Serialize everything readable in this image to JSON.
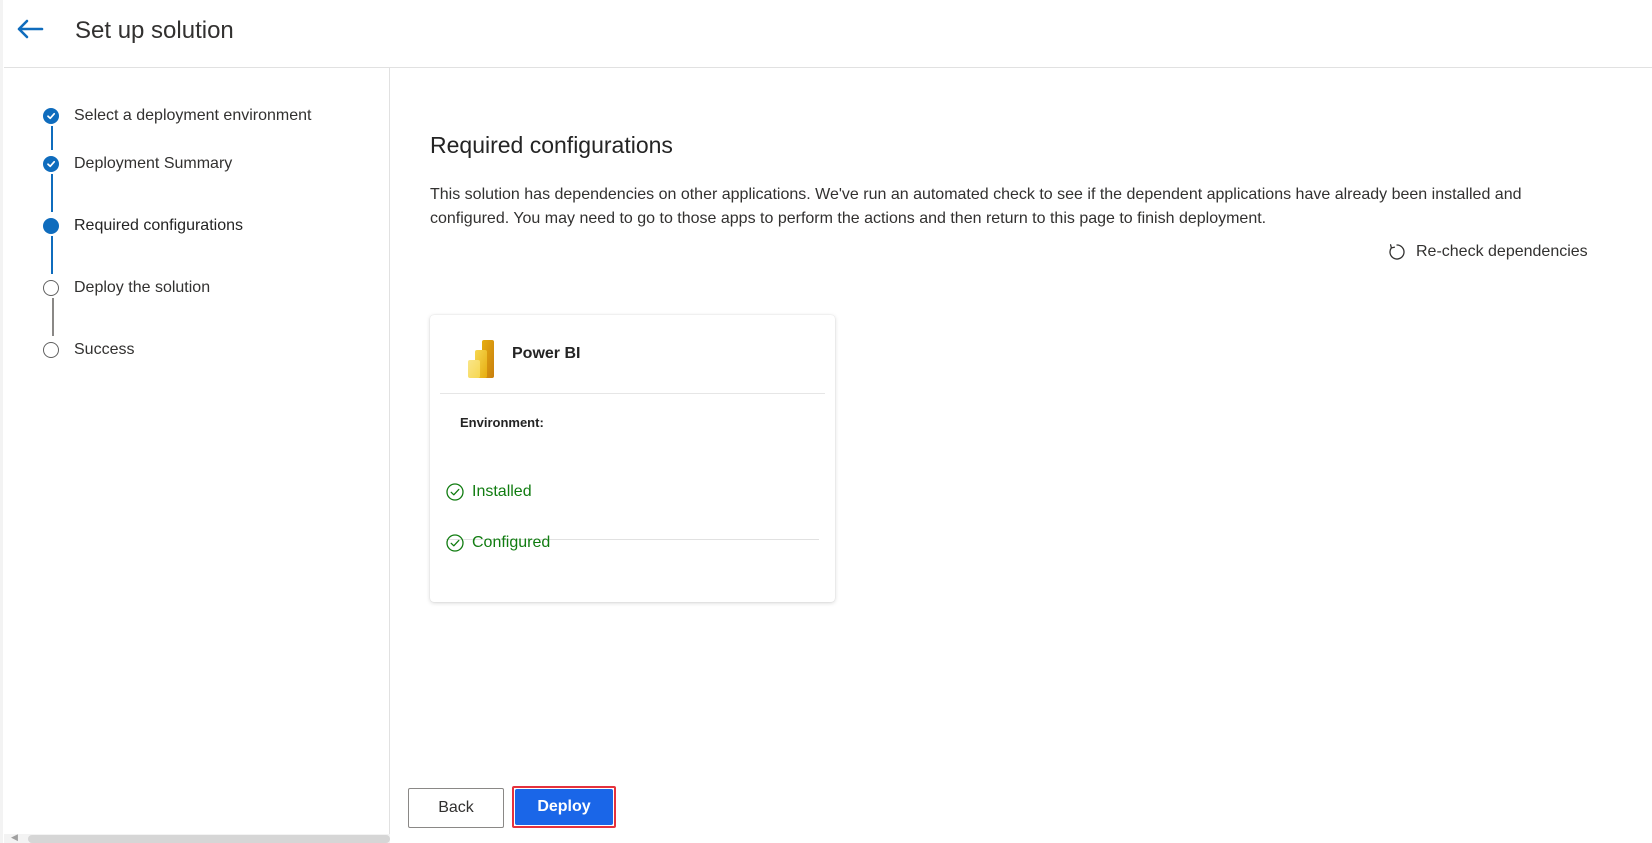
{
  "header": {
    "title": "Set up solution"
  },
  "wizard": {
    "steps": [
      {
        "label": "Select a deployment environment",
        "state": "done"
      },
      {
        "label": "Deployment Summary",
        "state": "done"
      },
      {
        "label": "Required configurations",
        "state": "current"
      },
      {
        "label": "Deploy the solution",
        "state": "todo"
      },
      {
        "label": "Success",
        "state": "todo"
      }
    ]
  },
  "main": {
    "title": "Required configurations",
    "description": "This solution has dependencies on other applications. We've run an automated check to see if the dependent applications have already been installed and configured. You may need to go to those apps to perform the actions and then return to this page to finish deployment.",
    "recheck_label": "Re-check dependencies",
    "card": {
      "app_name": "Power BI",
      "icon": "power-bi-icon",
      "environment_label": "Environment:",
      "statuses": [
        {
          "label": "Installed",
          "icon": "check-circle-icon"
        },
        {
          "label": "Configured",
          "icon": "check-circle-icon"
        }
      ]
    }
  },
  "footer": {
    "back_label": "Back",
    "deploy_label": "Deploy"
  },
  "colors": {
    "accent": "#0f6cbd",
    "deploy_button": "#1a66e8",
    "success": "#107c10",
    "highlight_border": "#e5323d"
  }
}
